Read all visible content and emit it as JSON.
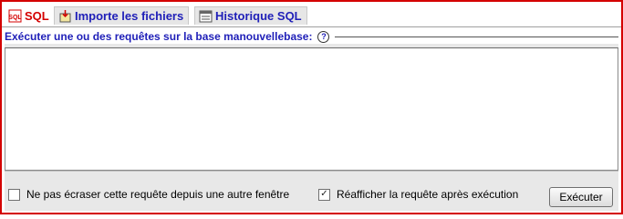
{
  "tabs": [
    {
      "label": "SQL",
      "icon": "sql-icon",
      "active": true
    },
    {
      "label": "Importe les fichiers",
      "icon": "import-icon",
      "active": false
    },
    {
      "label": "Historique SQL",
      "icon": "history-icon",
      "active": false
    }
  ],
  "query_form": {
    "legend": "Exécuter une ou des requêtes sur la base manouvellebase:",
    "help_label": "?",
    "sql_value": ""
  },
  "options": {
    "no_overwrite_label": "Ne pas écraser cette requête depuis une autre fenêtre",
    "no_overwrite_checked": false,
    "show_again_label": "Réafficher la requête après exécution",
    "show_again_checked": true,
    "check_mark": "✓"
  },
  "submit_label": "Exécuter",
  "colors": {
    "frame_border": "#d40000",
    "tab_text": "#1f1fb8",
    "active_tab_text": "#d40000",
    "legend_text": "#1f1fb8",
    "panel_bg": "#e8e8e8"
  }
}
